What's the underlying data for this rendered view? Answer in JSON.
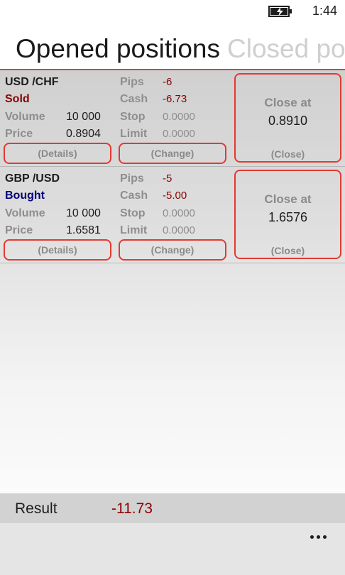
{
  "status_bar": {
    "time": "1:44",
    "battery_icon": "battery-charging-icon"
  },
  "pivot": {
    "active_tab": "Opened positions",
    "next_tab": "Closed positions"
  },
  "labels": {
    "volume": "Volume",
    "price": "Price",
    "pips": "Pips",
    "cash": "Cash",
    "stop": "Stop",
    "limit": "Limit",
    "details_button": "(Details)",
    "change_button": "(Change)",
    "close_at": "Close at",
    "close_button": "(Close)"
  },
  "positions": [
    {
      "symbol": "USD /CHF",
      "side": "Sold",
      "volume": "10 000",
      "price": "0.8904",
      "pips": "-6",
      "cash": "-6.73",
      "stop": "0.0000",
      "limit": "0.0000",
      "close_rate": "0.8910"
    },
    {
      "symbol": "GBP /USD",
      "side": "Bought",
      "volume": "10 000",
      "price": "1.6581",
      "pips": "-5",
      "cash": "-5.00",
      "stop": "0.0000",
      "limit": "0.0000",
      "close_rate": "1.6576"
    }
  ],
  "summary": {
    "result_label": "Result",
    "result_value": "-11.73"
  },
  "app_bar": {
    "more_icon": "ellipsis-icon"
  },
  "colors": {
    "accent": "#e23a32",
    "negative": "#8b0000",
    "bought": "#00007a"
  }
}
